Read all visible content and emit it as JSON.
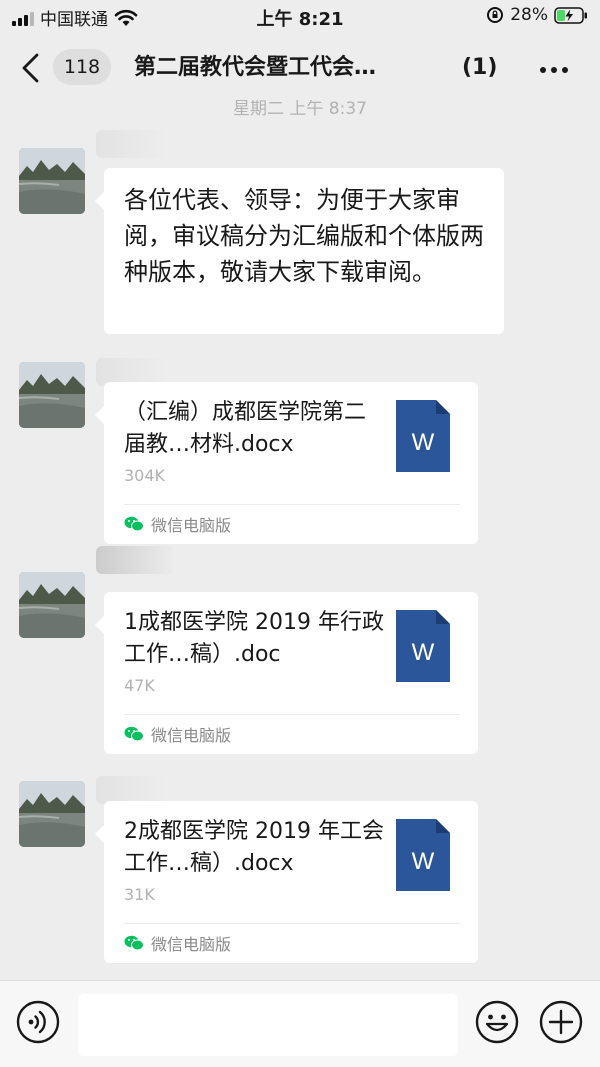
{
  "status_bar": {
    "carrier": "中国联通",
    "time": "上午 8:21",
    "battery": "28%"
  },
  "nav": {
    "unread_count": "118",
    "title": "第二届教代会暨工代会…",
    "member_count": "(1)"
  },
  "chat": {
    "timestamp": "星期二 上午 8:37",
    "messages": [
      {
        "type": "text",
        "text": "各位代表、领导：为便于大家审阅，审议稿分为汇编版和个体版两种版本，敬请大家下载审阅。"
      },
      {
        "type": "file",
        "file_name": "（汇编）成都医学院第二届教…材料.docx",
        "file_size": "304K",
        "source": "微信电脑版",
        "icon_letter": "W"
      },
      {
        "type": "file",
        "file_name": "1成都医学院 2019 年行政工作…稿）.doc",
        "file_size": "47K",
        "source": "微信电脑版",
        "icon_letter": "W"
      },
      {
        "type": "file",
        "file_name": "2成都医学院 2019 年工会工作…稿）.docx",
        "file_size": "31K",
        "source": "微信电脑版",
        "icon_letter": "W"
      }
    ]
  },
  "colors": {
    "background": "#ededed",
    "bubble": "#ffffff",
    "word_blue": "#2b579a",
    "wechat_green": "#07c160"
  },
  "icons": {
    "back": "chevron-left-icon",
    "more": "more-dots-icon",
    "voice": "voice-icon",
    "emoji": "emoji-icon",
    "plus": "plus-icon",
    "word_doc": "word-doc-icon"
  }
}
